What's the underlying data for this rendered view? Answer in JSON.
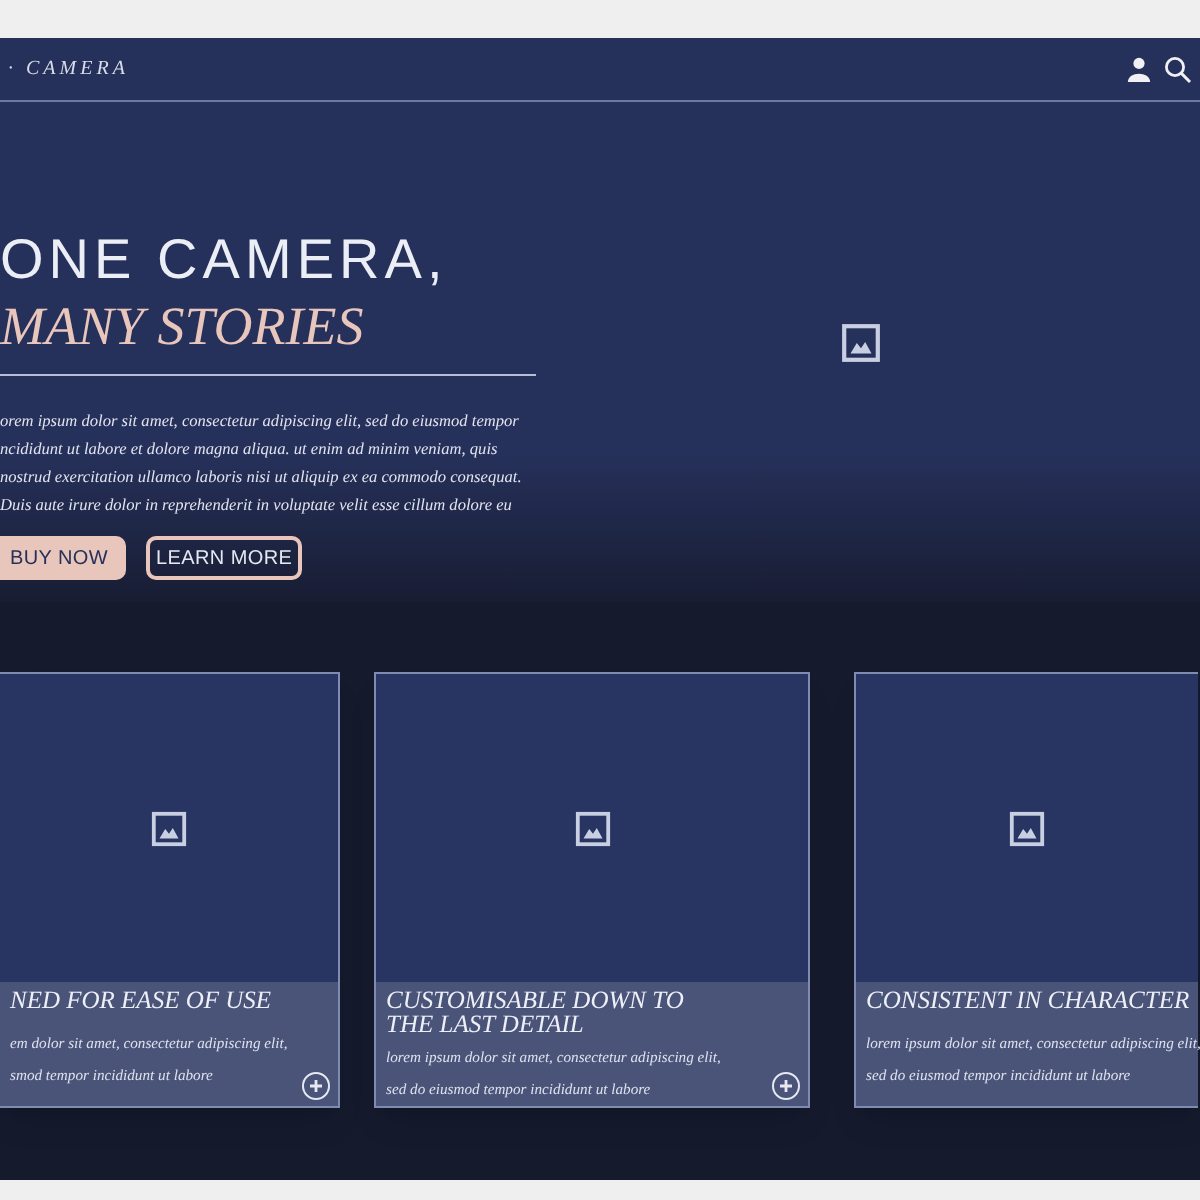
{
  "nav": {
    "brand": "· CAMERA"
  },
  "hero": {
    "title": "ONE CAMERA,",
    "subtitle": "MANY STORIES",
    "body_lines": [
      "orem ipsum dolor sit amet, consectetur adipiscing elit, sed do eiusmod tempor",
      "ncididunt ut labore et dolore magna aliqua. ut enim ad minim veniam, quis",
      "nostrud exercitation ullamco laboris nisi ut aliquip ex ea commodo consequat.",
      "Duis aute irure dolor in reprehenderit in voluptate velit esse cillum dolore eu"
    ],
    "buttons": [
      {
        "label": "BUY NOW",
        "kind": "primary"
      },
      {
        "label": "LEARN MORE",
        "kind": "outline"
      }
    ]
  },
  "features": [
    {
      "title_lines": [
        "NED FOR EASE OF USE"
      ],
      "body_lines": [
        "em dolor sit amet, consectetur adipiscing elit,",
        "smod tempor incididunt ut labore"
      ],
      "more_button": true
    },
    {
      "title_lines": [
        "CUSTOMISABLE DOWN TO",
        "THE LAST DETAIL"
      ],
      "body_lines": [
        "lorem ipsum dolor sit amet, consectetur adipiscing elit,",
        "sed do eiusmod tempor incididunt ut labore"
      ],
      "more_button": true
    },
    {
      "title_lines": [
        "CONSISTENT IN CHARACTER"
      ],
      "body_lines": [
        "lorem ipsum dolor sit amet, consectetur adipiscing elit,",
        "sed do eiusmod tempor incididunt ut labore"
      ],
      "more_button": false
    }
  ]
}
